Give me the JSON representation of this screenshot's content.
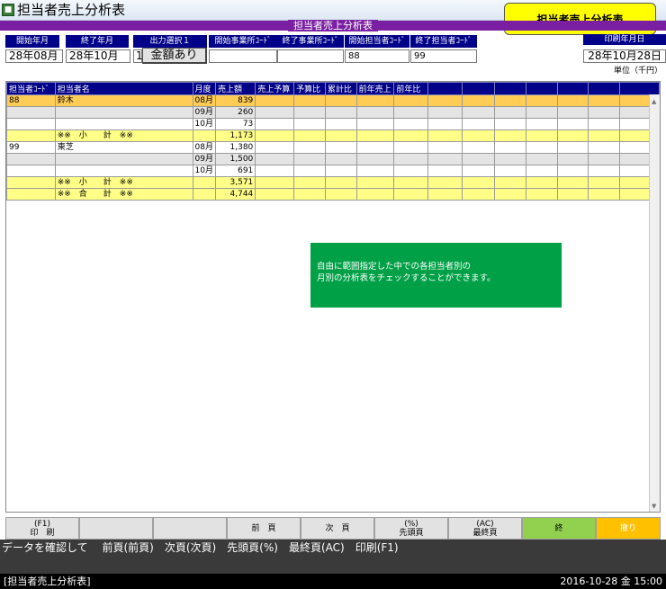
{
  "window": {
    "title": "担当者売上分析表",
    "callout": "担当者売上分析表"
  },
  "band_title": "担当者売上分析表",
  "header": {
    "labels": [
      "開始年月",
      "終了年月",
      "出力選択１",
      "開始事業所ｺｰﾄﾞ",
      "終了事業所ｺｰﾄﾞ",
      "開始担当者ｺｰﾄﾞ",
      "終了担当者ｺｰﾄﾞ"
    ],
    "values": {
      "start_month": "28年08月",
      "end_month": "28年10月",
      "output_select": "1",
      "amount_button": "金額あり",
      "start_office": "",
      "end_office": "",
      "start_staff": "88",
      "end_staff": "99"
    },
    "print_date_label": "印刷年月日",
    "print_date": "28年10月28日",
    "unit": "単位（千円）"
  },
  "table": {
    "columns": [
      "担当者ｺｰﾄﾞ",
      "担当者名",
      "月度",
      "売上額",
      "売上予算",
      "予算比",
      "累計比",
      "前年売上",
      "前年比",
      "",
      "",
      "",
      "",
      "",
      "",
      ""
    ],
    "rows": [
      {
        "style": "hl",
        "cells": [
          "88",
          "鈴木",
          "08月",
          "839",
          "",
          "",
          "",
          "",
          ""
        ]
      },
      {
        "style": "gray",
        "cells": [
          "",
          "",
          "09月",
          "260",
          "",
          "",
          "",
          "",
          ""
        ]
      },
      {
        "style": "white",
        "cells": [
          "",
          "",
          "10月",
          "73",
          "",
          "",
          "",
          "",
          ""
        ]
      },
      {
        "style": "sub",
        "cells": [
          "",
          "※※　小　　計　※※",
          "",
          "1,173",
          "",
          "",
          "",
          "",
          ""
        ]
      },
      {
        "style": "white",
        "cells": [
          "99",
          "東芝",
          "08月",
          "1,380",
          "",
          "",
          "",
          "",
          ""
        ]
      },
      {
        "style": "gray",
        "cells": [
          "",
          "",
          "09月",
          "1,500",
          "",
          "",
          "",
          "",
          ""
        ]
      },
      {
        "style": "white",
        "cells": [
          "",
          "",
          "10月",
          "691",
          "",
          "",
          "",
          "",
          ""
        ]
      },
      {
        "style": "sub",
        "cells": [
          "",
          "※※　小　　計　※※",
          "",
          "3,571",
          "",
          "",
          "",
          "",
          ""
        ]
      },
      {
        "style": "sub",
        "cells": [
          "",
          "※※　合　　計　※※",
          "",
          "4,744",
          "",
          "",
          "",
          "",
          ""
        ]
      }
    ]
  },
  "note": [
    "自由に範囲指定した中での各担当者別の",
    "月別の分析表をチェックすることができます。"
  ],
  "function_keys": [
    {
      "top": "(F1)",
      "bottom": "印　刷"
    },
    {
      "top": "",
      "bottom": ""
    },
    {
      "top": "",
      "bottom": ""
    },
    {
      "top": "",
      "bottom": "前　頁"
    },
    {
      "top": "",
      "bottom": "次　頁"
    },
    {
      "top": "(%)",
      "bottom": "先頭頁"
    },
    {
      "top": "(AC)",
      "bottom": "最終頁"
    },
    {
      "top": "",
      "bottom": "終"
    },
    {
      "top": "",
      "bottom": "撤り"
    }
  ],
  "status": {
    "message": "データを確認して　 前頁(前頁)　次頁(次頁)　先頭頁(%)　最終頁(AC)　印刷(F1)",
    "screen": "[担当者売上分析表]",
    "datetime": "2016-10-28 金 15:00"
  }
}
